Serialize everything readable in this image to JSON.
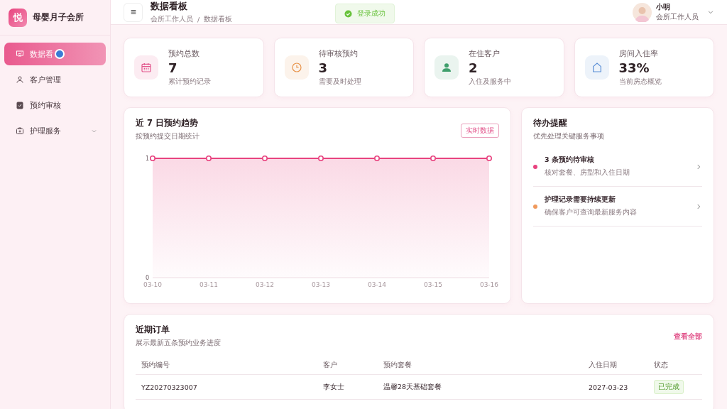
{
  "brand": {
    "logo": "悦",
    "name": "母婴月子会所"
  },
  "sidebar": {
    "items": [
      {
        "label": "数据看",
        "selected": true,
        "has_children": false
      },
      {
        "label": "客户管理",
        "selected": false,
        "has_children": false
      },
      {
        "label": "预约审核",
        "selected": false,
        "has_children": false
      },
      {
        "label": "护理服务",
        "selected": false,
        "has_children": true
      }
    ]
  },
  "header": {
    "title": "数据看板",
    "breadcrumb": [
      "会所工作人员",
      "数据看板"
    ],
    "separator": "/"
  },
  "toast": {
    "text": "登录成功"
  },
  "user": {
    "name": "小明",
    "role": "会所工作人员"
  },
  "stats": [
    {
      "label": "预约总数",
      "value": "7",
      "note": "累计预约记录",
      "color": "#e2558c"
    },
    {
      "label": "待审核预约",
      "value": "3",
      "note": "需要及时处理",
      "color": "#e8934a"
    },
    {
      "label": "在住客户",
      "value": "2",
      "note": "入住及服务中",
      "color": "#3f9f6c"
    },
    {
      "label": "房间入住率",
      "value": "33%",
      "note": "当前房态概览",
      "color": "#5b8fd6"
    }
  ],
  "trend": {
    "title": "近 7 日预约趋势",
    "subtitle": "按预约提交日期统计",
    "badge": "实时数据",
    "chart_data": {
      "type": "line",
      "categories": [
        "03-10",
        "03-11",
        "03-12",
        "03-13",
        "03-14",
        "03-15",
        "03-16"
      ],
      "series": [
        {
          "color": "#e8437f",
          "marker": "circle",
          "values": [
            1,
            1,
            1,
            1,
            1,
            1,
            1
          ]
        }
      ],
      "ylim": [
        0,
        1
      ],
      "yticks": [
        0,
        1
      ]
    }
  },
  "todo": {
    "title": "待办提醒",
    "subtitle": "优先处理关键服务事项",
    "items": [
      {
        "title": "3 条预约待审核",
        "desc": "核对套餐、房型和入住日期",
        "color": "#e8437f"
      },
      {
        "title": "护理记录需要持续更新",
        "desc": "确保客户可查询最新服务内容",
        "color": "#f0995c"
      }
    ]
  },
  "orders": {
    "title": "近期订单",
    "subtitle": "展示最新五条预约业务进度",
    "link": "查看全部",
    "columns": [
      "预约编号",
      "客户",
      "预约套餐",
      "入住日期",
      "状态"
    ],
    "rows": [
      {
        "id": "YZ20270323007",
        "customer": "李女士",
        "package": "温馨28天基础套餐",
        "date": "2027-03-23",
        "status": "已完成"
      }
    ]
  }
}
